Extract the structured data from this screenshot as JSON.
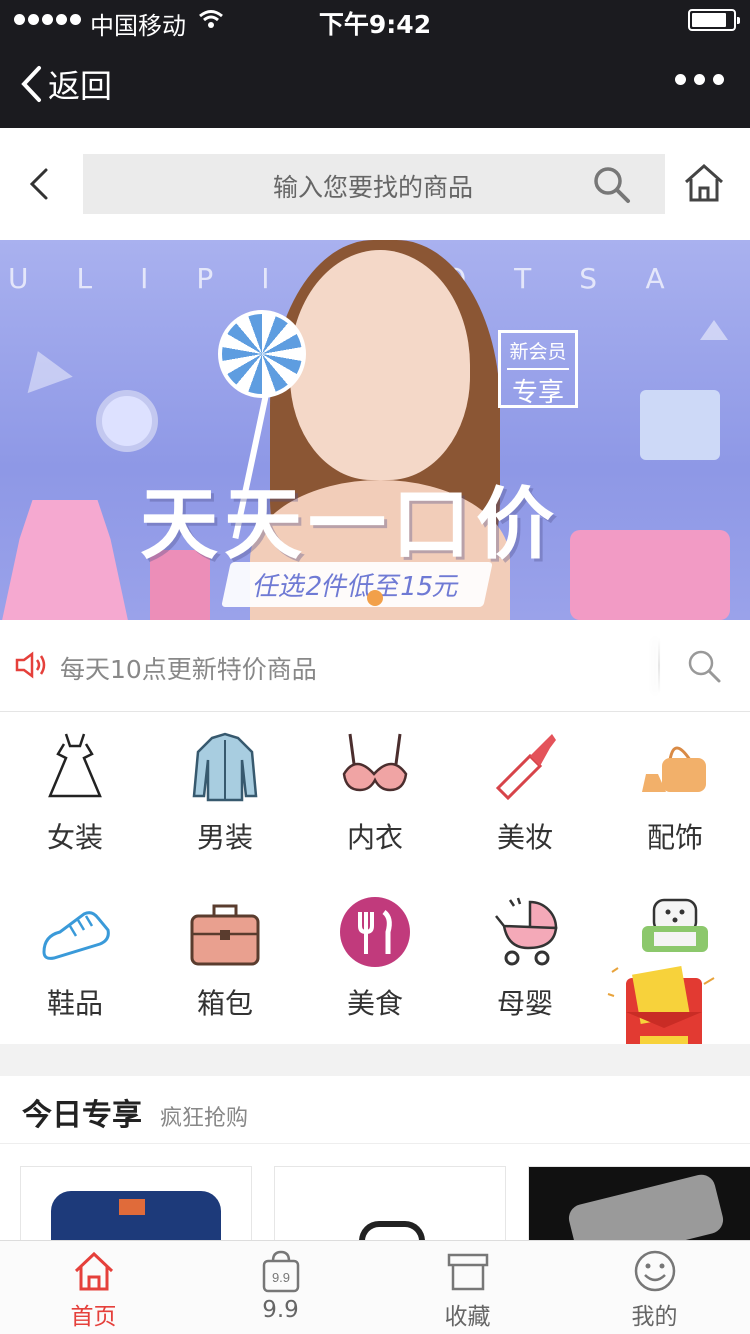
{
  "status_bar": {
    "carrier": "中国移动",
    "time": "下午9:42",
    "battery_level": 0.85
  },
  "nav_bar": {
    "back_label": "返回"
  },
  "search": {
    "placeholder": "输入您要找的商品"
  },
  "banner": {
    "top_letters": "ULIPIG OTSA",
    "badge_line1": "新会员",
    "badge_line2": "专享",
    "headline": "天天一口价",
    "subline": "任选2件低至15元"
  },
  "notice": {
    "text": "每天10点更新特价商品"
  },
  "categories": [
    {
      "label": "女装",
      "icon": "dress-icon"
    },
    {
      "label": "男装",
      "icon": "jacket-icon"
    },
    {
      "label": "内衣",
      "icon": "bra-icon"
    },
    {
      "label": "美妆",
      "icon": "lipstick-icon"
    },
    {
      "label": "配饰",
      "icon": "accessory-icon"
    },
    {
      "label": "鞋品",
      "icon": "shoe-icon"
    },
    {
      "label": "箱包",
      "icon": "bag-icon"
    },
    {
      "label": "美食",
      "icon": "food-icon"
    },
    {
      "label": "母婴",
      "icon": "stroller-icon"
    },
    {
      "label": "",
      "icon": "sofa-icon"
    }
  ],
  "today": {
    "title": "今日专享",
    "subtitle": "疯狂抢购"
  },
  "tabs": [
    {
      "label": "首页",
      "active": true
    },
    {
      "label": "9.9",
      "active": false
    },
    {
      "label": "收藏",
      "active": false
    },
    {
      "label": "我的",
      "active": false
    }
  ],
  "colors": {
    "accent": "#e5403b",
    "nav_dark": "#1b1b1f",
    "banner": "#9aa2ea"
  }
}
